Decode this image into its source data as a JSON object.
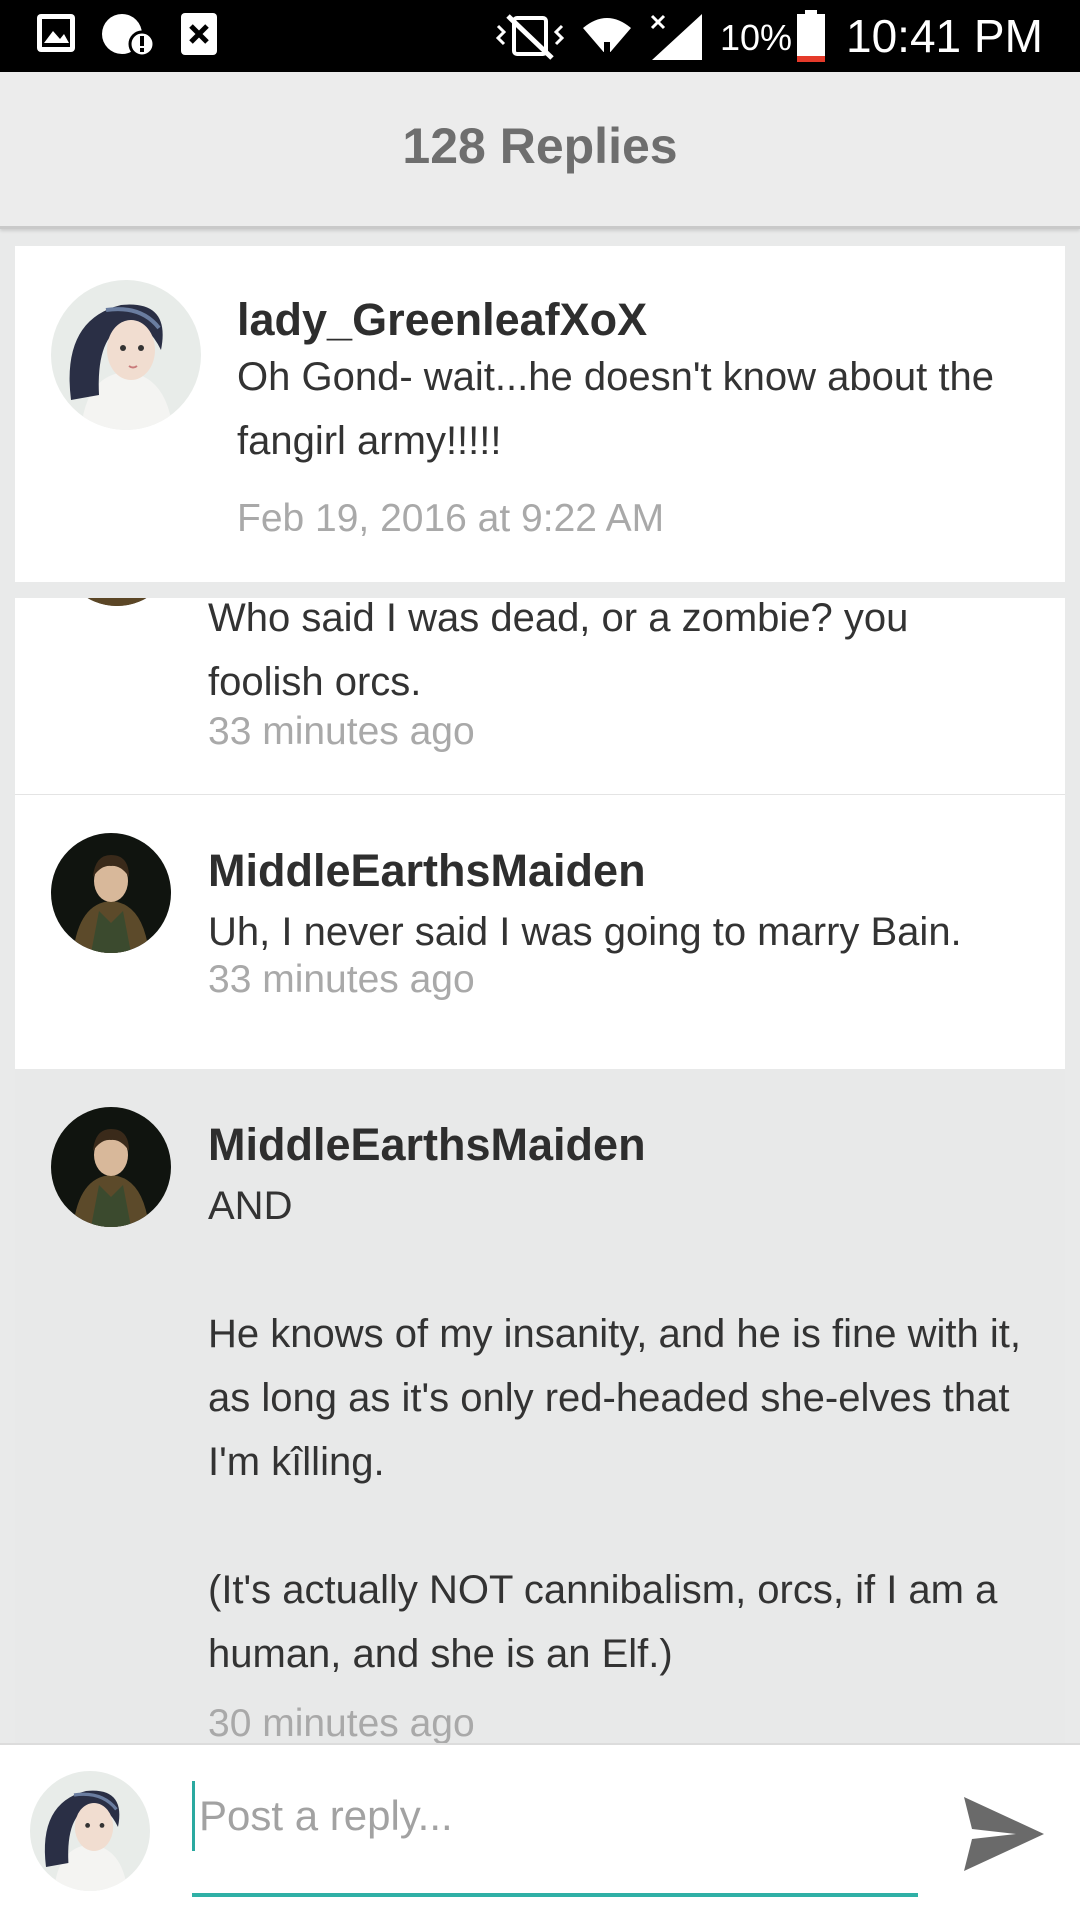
{
  "status_bar": {
    "icons_left": [
      "gallery-icon",
      "notification-alert-icon",
      "close-box-icon"
    ],
    "icons_right": [
      "vibrate-mute-icon",
      "wifi-icon",
      "signal-icon",
      "battery-icon"
    ],
    "battery_percent": "10%",
    "time": "10:41 PM"
  },
  "header": {
    "title": "128 Replies"
  },
  "parent_post": {
    "username": "lady_GreenleafXoX",
    "message": "Oh Gond- wait...he doesn't know about the fangirl army!!!!!",
    "timestamp": "Feb 19, 2016 at 9:22 AM"
  },
  "replies": [
    {
      "username": "",
      "message": "Who said I was dead, or a zombie? you foolish orcs.",
      "timestamp": "33 minutes ago"
    },
    {
      "username": "MiddleEarthsMaiden",
      "message": "Uh, I never said I was going to marry Bain.",
      "timestamp": "33 minutes ago"
    },
    {
      "username": "MiddleEarthsMaiden",
      "message": "AND\n\nHe knows of my insanity, and he is fine with it, as long as it's only red-headed she-elves that I'm kîlling.\n\n(It's actually NOT cannibalism, orcs, if I am a human, and she is an Elf.)",
      "timestamp": "30 minutes ago"
    }
  ],
  "composer": {
    "placeholder": "Post a reply...",
    "value": ""
  },
  "colors": {
    "accent": "#2fb0a6",
    "header_bg": "#ececec",
    "highlight_bg": "#e8e9e9"
  }
}
